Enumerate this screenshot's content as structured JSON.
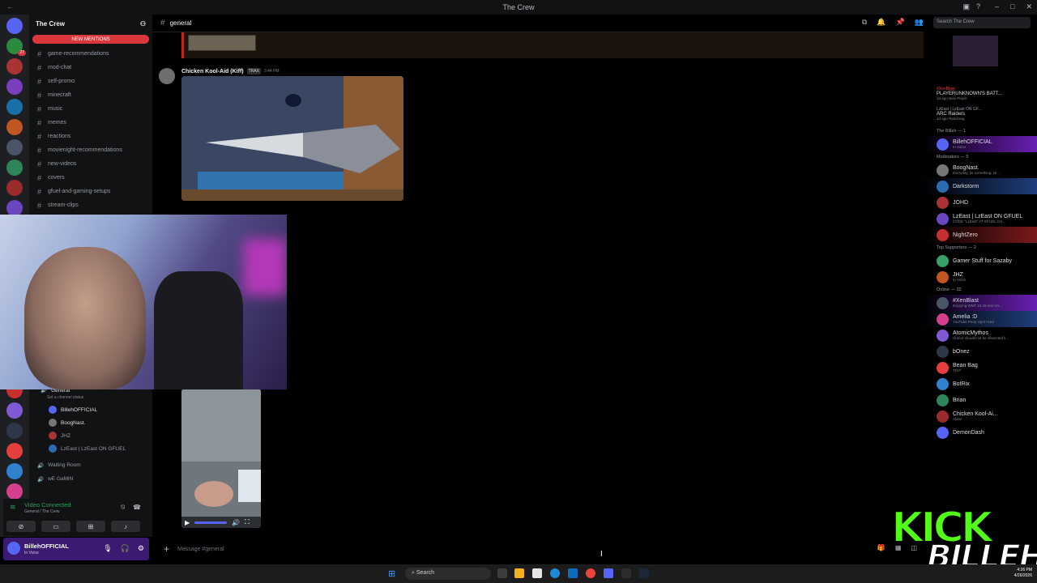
{
  "window": {
    "title": "The Crew"
  },
  "server": {
    "name": "The Crew",
    "new_mentions": "NEW MENTIONS"
  },
  "channels": [
    {
      "name": "game-recommendations"
    },
    {
      "name": "mod-chat"
    },
    {
      "name": "self-promo"
    },
    {
      "name": "minecraft"
    },
    {
      "name": "music"
    },
    {
      "name": "memes"
    },
    {
      "name": "reactions"
    },
    {
      "name": "movienight-recommendations"
    },
    {
      "name": "new-videos"
    },
    {
      "name": "covers"
    },
    {
      "name": "gfuel-and-gaming-setups"
    },
    {
      "name": "stream-clips"
    }
  ],
  "voice": {
    "channel": "General",
    "status": "Set a channel status",
    "members": [
      "BillehOFFICIAL",
      "BoogNast.",
      "JHZ",
      "LzEast | LzEast ON GFUEL"
    ],
    "other_channels": [
      "Waiting Room",
      "wE GaMiN"
    ]
  },
  "voice_panel": {
    "title": "Video Connected",
    "subtitle": "General / The Crew"
  },
  "user": {
    "name": "BillehOFFICIAL",
    "status": "In Voice"
  },
  "main": {
    "channel": "general",
    "search_placeholder": "Search The Crew",
    "message": {
      "author": "Chicken Kool-Aid (Kiff)",
      "tag": "TRAX",
      "time": "3:44 PM"
    },
    "input_placeholder": "Message #general"
  },
  "members": {
    "activities": [
      {
        "prefix": "#XenBlast",
        "title": "PLAYERUNKNOWN'S BATT...",
        "sub": "1d ago  New Player"
      },
      {
        "prefix": "LzEast | LzEast ON GF...",
        "title": "ARC Raiders",
        "sub": "1d ago  Returning"
      }
    ],
    "groups": [
      {
        "header": "The Billeh — 1",
        "items": [
          {
            "name": "BillehOFFICIAL",
            "sub": "In Voice",
            "hl": "hl"
          }
        ]
      },
      {
        "header": "Moderators — 5",
        "items": [
          {
            "name": "BoogNast.",
            "sub": "Everyday, its something. Hi...",
            "hl": ""
          },
          {
            "name": "Darkstorm",
            "sub": "",
            "hl": "hl2"
          },
          {
            "name": "JOHD",
            "sub": "",
            "hl": ""
          },
          {
            "name": "LzEast | LzEast ON GFUEL",
            "sub": "CODE \"LzEast\" AT GFUEL CH...",
            "hl": ""
          },
          {
            "name": "NightZero",
            "sub": "",
            "hl": "hl3"
          }
        ]
      },
      {
        "header": "Top Supporters — 2",
        "items": [
          {
            "name": "Gamer Stuff for Sazaby",
            "sub": "",
            "hl": ""
          },
          {
            "name": "JHZ",
            "sub": "In Voice",
            "hl": ""
          }
        ]
      },
      {
        "header": "Online — 32",
        "items": [
          {
            "name": "#XenBlast",
            "sub": "Enjoying WMT 24.26 and VA...",
            "hl": "hl"
          },
          {
            "name": "Amelia :D",
            "sub": "YouTube Peep Spot Hunt",
            "hl": "hl2"
          },
          {
            "name": "AtomicMythos",
            "sub": "Humor should not be dissected li...",
            "hl": ""
          },
          {
            "name": "bOnez",
            "sub": "",
            "hl": ""
          },
          {
            "name": "Bean Bag",
            "sub": "TGIF",
            "hl": ""
          },
          {
            "name": "BotRix",
            "sub": "",
            "hl": ""
          },
          {
            "name": "Brian",
            "sub": "",
            "hl": ""
          },
          {
            "name": "Chicken Kool-Ai...",
            "sub": "Alone",
            "hl": ""
          },
          {
            "name": "DemonDash",
            "sub": "",
            "hl": ""
          }
        ]
      }
    ]
  },
  "taskbar": {
    "search": "Search",
    "time": "4:26 PM",
    "date": "4/26/2026"
  },
  "overlay": {
    "brand": "KICK",
    "name": "BILLEH"
  },
  "colors": {
    "accent": "#5865f2",
    "green": "#23a55a",
    "mention": "#da373c",
    "kick": "#53fc18"
  }
}
